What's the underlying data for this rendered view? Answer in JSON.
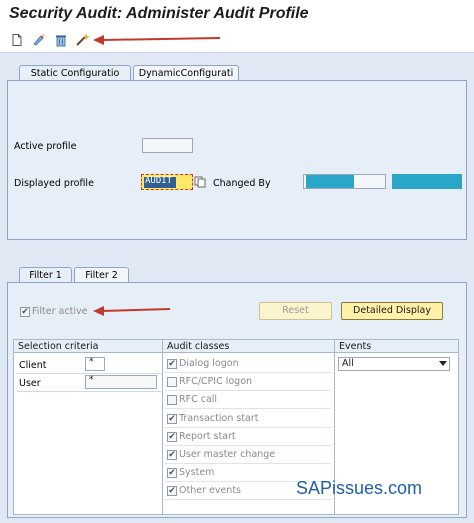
{
  "window": {
    "title": "Security Audit: Administer Audit Profile"
  },
  "toolbar": {
    "icons": [
      "new-document-icon",
      "edit-icon",
      "delete-icon",
      "magic-wand-icon"
    ]
  },
  "config_tabs": [
    {
      "label": "Static Configuratio",
      "active": true
    },
    {
      "label": "DynamicConfigurati",
      "active": false
    }
  ],
  "config": {
    "active_profile_label": "Active profile",
    "active_profile_value": "",
    "displayed_profile_label": "Displayed profile",
    "displayed_profile_value": "AUDIT",
    "changed_by_label": "Changed By"
  },
  "filter_tabs": [
    {
      "label": "Filter 1",
      "active": true
    },
    {
      "label": "Filter 2",
      "active": false
    }
  ],
  "filter": {
    "filter_active_label": "Filter active",
    "filter_active_checked": true,
    "reset_label": "Reset",
    "detailed_display_label": "Detailed Display"
  },
  "selection": {
    "header": "Selection criteria",
    "client_label": "Client",
    "client_value": "*",
    "user_label": "User",
    "user_value": "*"
  },
  "audit": {
    "header": "Audit classes",
    "classes": [
      {
        "label": "Dialog logon",
        "checked": true
      },
      {
        "label": "RFC/CPIC logon",
        "checked": false
      },
      {
        "label": "RFC call",
        "checked": false
      },
      {
        "label": "Transaction start",
        "checked": true
      },
      {
        "label": "Report start",
        "checked": true
      },
      {
        "label": "User master change",
        "checked": true
      },
      {
        "label": "System",
        "checked": true
      },
      {
        "label": "Other events",
        "checked": true
      }
    ]
  },
  "events": {
    "header": "Events",
    "selected": "All"
  },
  "watermark": "SAPissues.com",
  "colors": {
    "arrow": "#c0392b",
    "highlight": "#ffe86a",
    "teal": "#2aa6c9"
  }
}
